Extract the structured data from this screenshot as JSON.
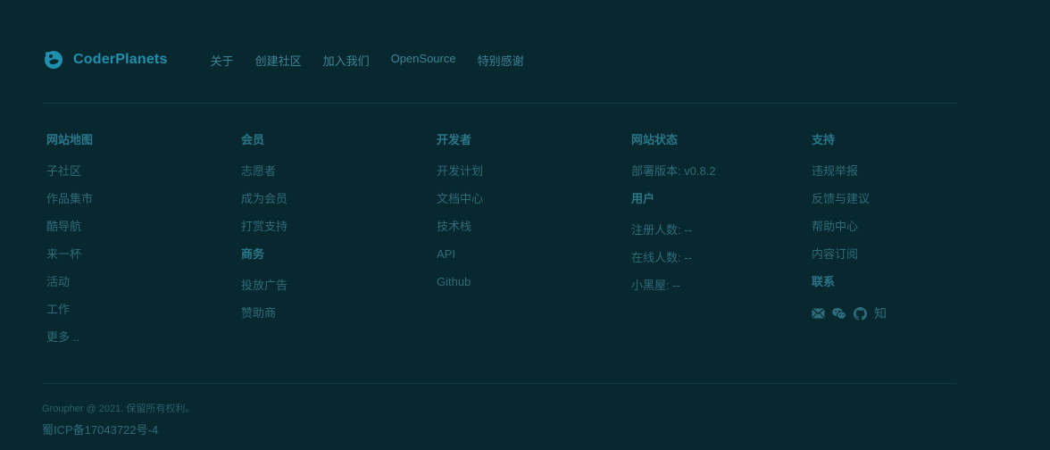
{
  "brand": {
    "name": "CoderPlanets",
    "accent_color": "#1f8fae"
  },
  "top_nav": [
    "关于",
    "创建社区",
    "加入我们",
    "OpenSource",
    "特别感谢"
  ],
  "columns": {
    "site_map": {
      "title": "网站地图",
      "links": [
        "子社区",
        "作品集市",
        "酷导航",
        "来一杯",
        "活动",
        "工作",
        "更多 .."
      ]
    },
    "member": {
      "title": "会员",
      "links": [
        "志愿者",
        "成为会员",
        "打赏支持"
      ],
      "business": {
        "title": "商务",
        "links": [
          "投放广告",
          "赞助商"
        ]
      }
    },
    "developer": {
      "title": "开发者",
      "links": [
        "开发计划",
        "文档中心",
        "技术栈",
        "API",
        "Github"
      ]
    },
    "site_status": {
      "title": "网站状态",
      "deploy_version": "部署版本: v0.8.2",
      "users": {
        "title": "用户",
        "registered": "注册人数: --",
        "online": "在线人数: --",
        "dark_room": "小黑屋: --"
      }
    },
    "support": {
      "title": "支持",
      "links": [
        "违规举报",
        "反馈与建议",
        "帮助中心",
        "内容订阅"
      ],
      "contact": {
        "title": "联系",
        "icons": [
          "mail-icon",
          "wechat-icon",
          "github-icon"
        ],
        "zhihu_label": "知"
      }
    }
  },
  "footer": {
    "copyright": "Groupher @ 2021. 保留所有权利。",
    "icp": "蜀ICP备17043722号-4"
  }
}
